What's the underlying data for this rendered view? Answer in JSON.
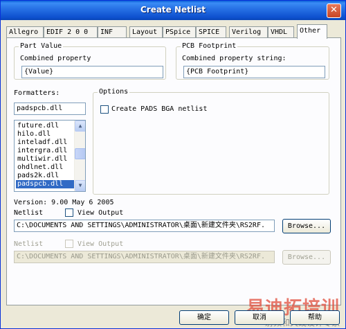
{
  "window": {
    "title": "Create Netlist",
    "close_glyph": "✕"
  },
  "tabs": [
    {
      "label": "Allegro"
    },
    {
      "label": "EDIF 2 0 0"
    },
    {
      "label": "INF"
    },
    {
      "label": "Layout"
    },
    {
      "label": "PSpice"
    },
    {
      "label": "SPICE"
    },
    {
      "label": "Verilog"
    },
    {
      "label": "VHDL"
    },
    {
      "label": "Other",
      "active": true
    }
  ],
  "part_value": {
    "group_label": "Part Value",
    "field_label": "Combined property",
    "value": "{Value}"
  },
  "pcb_footprint": {
    "group_label": "PCB Footprint",
    "field_label": "Combined property string:",
    "value": "{PCB Footprint}"
  },
  "formatters": {
    "label": "Formatters:",
    "value": "padspcb.dll",
    "items": [
      "future.dll",
      "hilo.dll",
      "inteladf.dll",
      "intergra.dll",
      "multiwir.dll",
      "ohdlnet.dll",
      "pads2k.dll",
      "padspcb.dll"
    ],
    "selected": "padspcb.dll",
    "scroll_up_icon": "▲",
    "scroll_down_icon": "▼"
  },
  "options": {
    "group_label": "Options",
    "checkbox_label": "Create PADS BGA netlist",
    "checked": false
  },
  "version_text": "Version: 9.00  May  6 2005",
  "netlist_active": {
    "label": "Netlist",
    "view_output_label": "View Output",
    "path": "C:\\DOCUMENTS AND SETTINGS\\ADMINISTRATOR\\桌面\\新建文件夹\\RS2RF.",
    "browse_label": "Browse..."
  },
  "netlist_disabled": {
    "label": "Netlist",
    "view_output_label": "View Output",
    "path": "C:\\DOCUMENTS AND SETTINGS\\ADMINISTRATOR\\桌面\\新建文件夹\\RS2RF.",
    "browse_label": "Browse..."
  },
  "footer": {
    "ok_label": "确定",
    "cancel_label": "取消",
    "help_label": "帮助"
  },
  "watermark": {
    "main": "易迪拓培训",
    "sub": "射频和天线设计专家"
  }
}
